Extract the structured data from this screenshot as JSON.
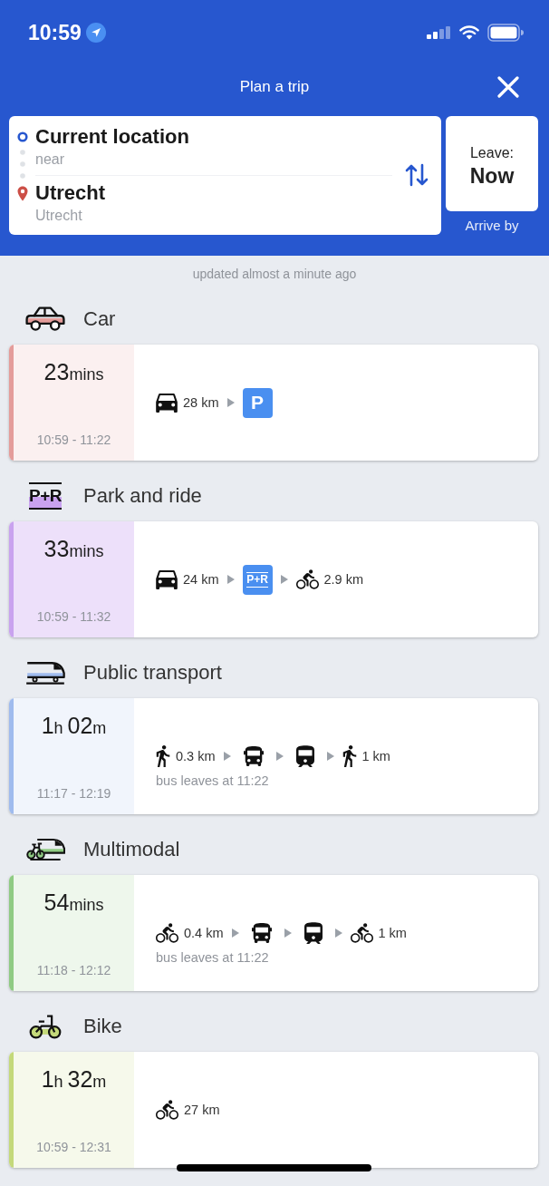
{
  "status_bar": {
    "time": "10:59"
  },
  "header": {
    "title": "Plan a trip"
  },
  "trip": {
    "origin": {
      "name": "Current location",
      "detail": "near"
    },
    "destination": {
      "name": "Utrecht",
      "detail": "Utrecht"
    },
    "departure": {
      "label": "Leave:",
      "value": "Now"
    },
    "alternative": "Arrive by"
  },
  "updated": "updated almost a minute ago",
  "sections": [
    {
      "kind": "car",
      "title": "Car",
      "color": "#e49c9a",
      "route": {
        "duration": "23mins",
        "times": "10:59 - 11:22",
        "legs": [
          {
            "kind": "car",
            "distance": "28 km"
          },
          {
            "kind": "parking",
            "label": "P"
          }
        ]
      }
    },
    {
      "kind": "park_and_ride",
      "icon_label": "P+R",
      "title": "Park and ride",
      "color": "#c9a2ef",
      "route": {
        "duration": "33mins",
        "times": "10:59 - 11:32",
        "legs": [
          {
            "kind": "car",
            "distance": "24 km"
          },
          {
            "kind": "park_and_ride",
            "label": "P+R"
          },
          {
            "kind": "bike",
            "distance": "2.9 km"
          }
        ]
      }
    },
    {
      "kind": "public_transport",
      "title": "Public transport",
      "color": "#9fbbee",
      "route": {
        "duration": "1h 02m",
        "times": "11:17 - 12:19",
        "legs": [
          {
            "kind": "walk",
            "distance": "0.3 km"
          },
          {
            "kind": "bus"
          },
          {
            "kind": "train"
          },
          {
            "kind": "walk",
            "distance": "1 km"
          }
        ],
        "note": "bus leaves at 11:22"
      }
    },
    {
      "kind": "multimodal",
      "title": "Multimodal",
      "color": "#8fcb83",
      "route": {
        "duration": "54mins",
        "times": "11:18 - 12:12",
        "legs": [
          {
            "kind": "bike",
            "distance": "0.4 km"
          },
          {
            "kind": "bus"
          },
          {
            "kind": "train"
          },
          {
            "kind": "bike",
            "distance": "1 km"
          }
        ],
        "note": "bus leaves at 11:22"
      }
    },
    {
      "kind": "bike",
      "title": "Bike",
      "color": "#c4d97a",
      "route": {
        "duration": "1h 32m",
        "times": "10:59 - 12:31",
        "legs": [
          {
            "kind": "bike",
            "distance": "27 km"
          }
        ]
      }
    }
  ]
}
